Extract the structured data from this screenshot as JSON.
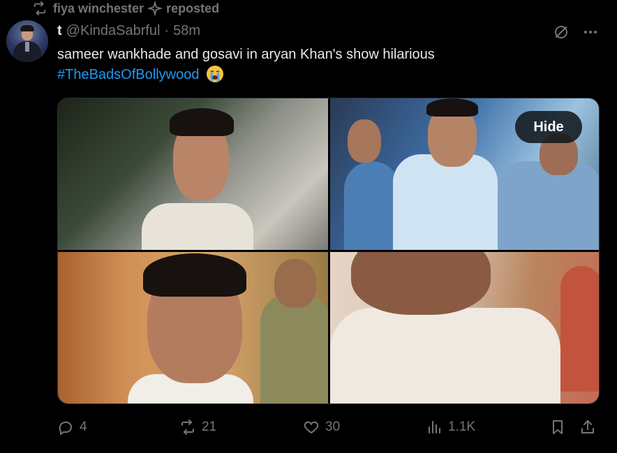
{
  "repost": {
    "name": "fiya winchester",
    "verb": "reposted",
    "icon": "repost-icon",
    "badge_icon": "sparkle-icon"
  },
  "tweet": {
    "display_name": "t",
    "handle": "@KindaSabrful",
    "separator": "·",
    "time": "58m",
    "text": "sameer wankhade and gosavi in aryan Khan's show hilarious",
    "hashtag": "#TheBadsOfBollywood",
    "emoji": "loudly-crying-face",
    "media_count": 4,
    "hide_label": "Hide"
  },
  "actions": {
    "reply_count": "4",
    "repost_count": "21",
    "like_count": "30",
    "views_count": "1.1K"
  },
  "colors": {
    "background": "#000000",
    "text": "#e7e9ea",
    "muted": "#71767b",
    "link": "#1d9bf0"
  }
}
